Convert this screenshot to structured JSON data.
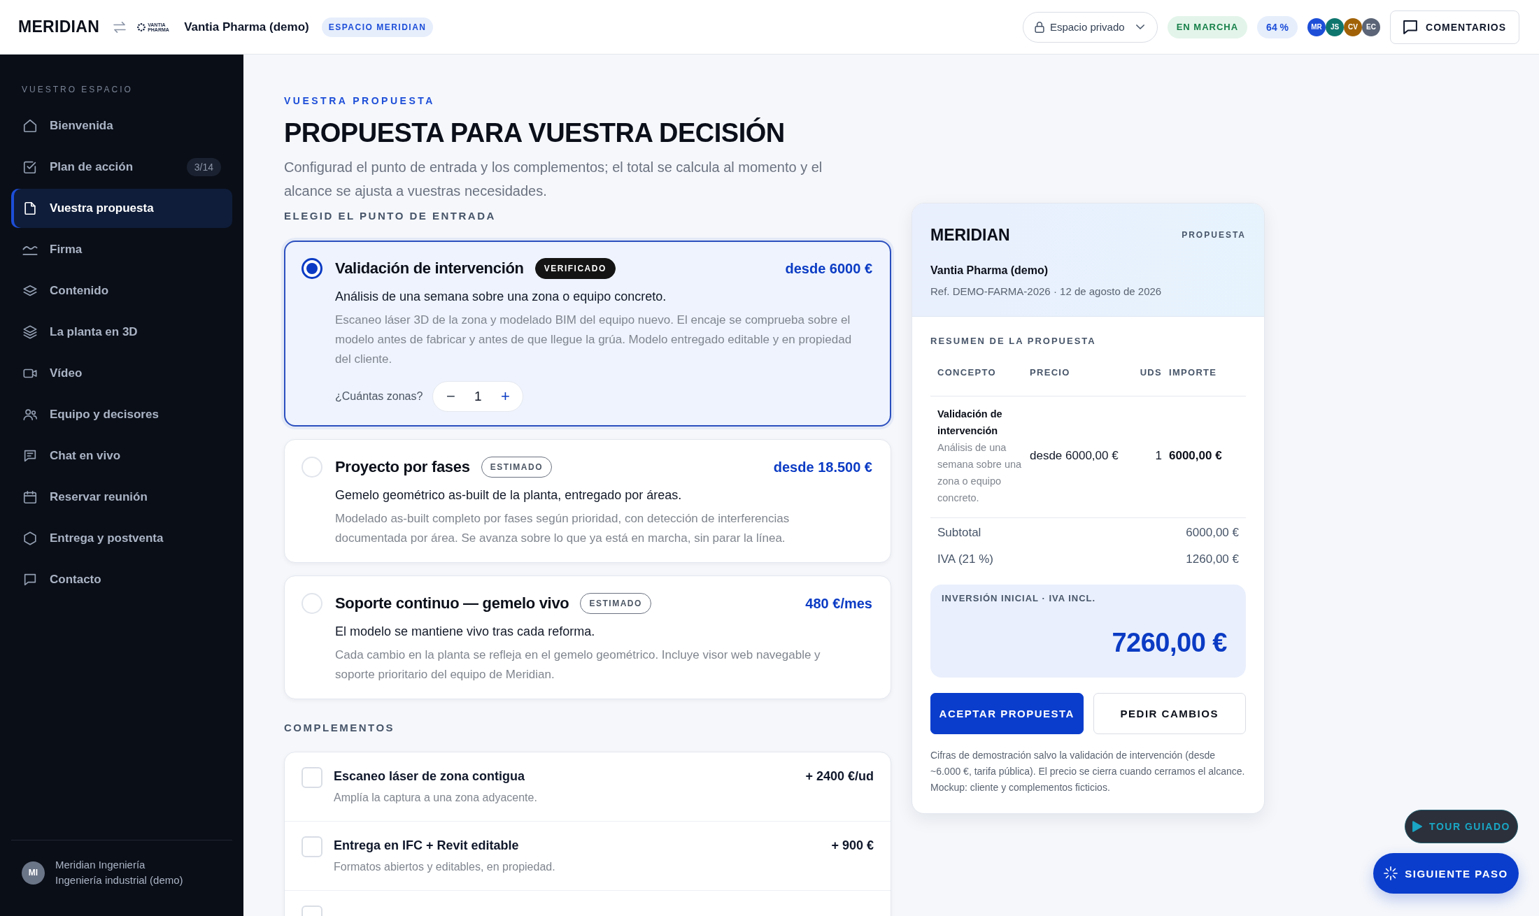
{
  "topbar": {
    "brand": "MERIDIAN",
    "client_logo_text": "VANTIA PHARMA",
    "client_name": "Vantia Pharma (demo)",
    "space_badge": "ESPACIO MERIDIAN",
    "privacy_dropdown": {
      "label": "Espacio privado"
    },
    "status_pill": "EN MARCHA",
    "progress_pill": "64 %",
    "avatars": [
      {
        "initials": "MR",
        "color": "#1d4ed8"
      },
      {
        "initials": "JS",
        "color": "#0f766e"
      },
      {
        "initials": "CV",
        "color": "#a16207"
      },
      {
        "initials": "EC",
        "color": "#5b6577"
      }
    ],
    "comments_button": "COMENTARIOS"
  },
  "sidebar": {
    "section_label": "VUESTRO ESPACIO",
    "items": [
      {
        "kind": "home",
        "label": "Bienvenida",
        "selected": false
      },
      {
        "kind": "task",
        "label": "Plan de acción",
        "badge": "3/14",
        "selected": false
      },
      {
        "kind": "document",
        "label": "Vuestra propuesta",
        "selected": true
      },
      {
        "kind": "signature",
        "label": "Firma",
        "selected": false
      },
      {
        "kind": "layers",
        "label": "Contenido",
        "selected": false
      },
      {
        "kind": "stack",
        "label": "La planta en 3D",
        "selected": false
      },
      {
        "kind": "video",
        "label": "Vídeo",
        "selected": false
      },
      {
        "kind": "team",
        "label": "Equipo y decisores",
        "selected": false
      },
      {
        "kind": "chat",
        "label": "Chat en vivo",
        "selected": false
      },
      {
        "kind": "calendar",
        "label": "Reservar reunión",
        "selected": false
      },
      {
        "kind": "hexagon",
        "label": "Entrega y postventa",
        "selected": false
      },
      {
        "kind": "message",
        "label": "Contacto",
        "selected": false
      }
    ],
    "footer": {
      "initials": "MI",
      "name": "Meridian Ingeniería",
      "subtitle": "Ingeniería industrial (demo)"
    }
  },
  "main": {
    "eyebrow": "VUESTRA PROPUESTA",
    "title": "PROPUESTA PARA VUESTRA DECISIÓN",
    "intro": "Configurad el punto de entrada y los complementos; el total se calcula al momento y el alcance se ajusta a vuestras necesidades.",
    "options_label": "ELEGID EL PUNTO DE ENTRADA",
    "options": [
      {
        "title": "Validación de intervención",
        "badge": {
          "kind": "verified",
          "text": "VERIFICADO"
        },
        "price": "desde 6000 €",
        "summary": "Análisis de una semana sobre una zona o equipo concreto.",
        "description": "Escaneo láser 3D de la zona y modelado BIM del equipo nuevo. El encaje se comprueba sobre el modelo antes de fabricar y antes de que llegue la grúa. Modelo entregado editable y en propiedad del cliente.",
        "selected": true,
        "quantity": {
          "label": "¿Cuántas zonas?",
          "decrement": "−",
          "value": "1",
          "increment": "+"
        }
      },
      {
        "title": "Proyecto por fases",
        "badge": {
          "kind": "estimate",
          "text": "ESTIMADO"
        },
        "price": "desde 18.500 €",
        "summary": "Gemelo geométrico as-built de la planta, entregado por áreas.",
        "description": "Modelado as-built completo por fases según prioridad, con detección de interferencias documentada por área. Se avanza sobre lo que ya está en marcha, sin parar la línea.",
        "selected": false
      },
      {
        "title": "Soporte continuo — gemelo vivo",
        "badge": {
          "kind": "estimate",
          "text": "ESTIMADO"
        },
        "price": "480 €/mes",
        "summary": "El modelo se mantiene vivo tras cada reforma.",
        "description": "Cada cambio en la planta se refleja en el gemelo geométrico. Incluye visor web navegable y soporte prioritario del equipo de Meridian.",
        "selected": false
      }
    ],
    "addons_label": "COMPLEMENTOS",
    "addons": [
      {
        "title": "Escaneo láser de zona contigua",
        "price": "+ 2400 €/ud",
        "description": "Amplía la captura a una zona adyacente.",
        "checked": false
      },
      {
        "title": "Entrega en IFC + Revit editable",
        "price": "+ 900 €",
        "description": "Formatos abiertos y editables, en propiedad.",
        "checked": false
      },
      {
        "checked": false
      }
    ]
  },
  "summary": {
    "brand": "MERIDIAN",
    "doc_label": "PROPUESTA",
    "client": "Vantia Pharma (demo)",
    "reference": "Ref. DEMO-FARMA-2026 · 12 de agosto de 2026",
    "section_label": "RESUMEN DE LA PROPUESTA",
    "table": {
      "columns": [
        "CONCEPTO",
        "PRECIO",
        "UDS",
        "IMPORTE"
      ],
      "rows": [
        {
          "concept": "Validación de intervención",
          "detail": "Análisis de una semana sobre una zona o equipo concreto.",
          "price": "desde 6000,00 €",
          "units": "1",
          "amount": "6000,00 €"
        }
      ]
    },
    "totals": [
      {
        "label": "Subtotal",
        "value": "6000,00 €"
      },
      {
        "label": "IVA (21 %)",
        "value": "1260,00 €"
      }
    ],
    "total": {
      "label": "INVERSIÓN INICIAL · IVA INCL.",
      "value": "7260,00 €"
    },
    "actions": [
      {
        "kind": "accept",
        "label": "ACEPTAR PROPUESTA"
      },
      {
        "kind": "changes",
        "label": "PEDIR CAMBIOS"
      }
    ],
    "footnote": "Cifras de demostración salvo la validación de intervención (desde ~6.000 €, tarifa pública). El precio se cierra cuando cerramos el alcance. Mockup: cliente y complementos ficticios."
  },
  "floating_buttons": [
    {
      "kind": "tour",
      "label": "TOUR GUIADO"
    },
    {
      "kind": "next",
      "label": "SIGUIENTE PASO"
    }
  ]
}
